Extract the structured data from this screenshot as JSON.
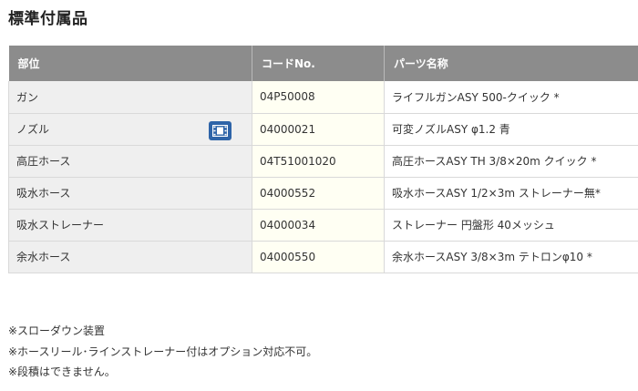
{
  "page": {
    "title": "標準付属品"
  },
  "table": {
    "headers": [
      "部位",
      "コードNo.",
      "パーツ名称"
    ],
    "rows": [
      {
        "part": "ガン",
        "code": "04P50008",
        "name": "ライフルガンASY 500-クイック *"
      },
      {
        "part": "ノズル",
        "code": "04000021",
        "name": "可変ノズルASY φ1.2 青",
        "icon": "video-film-icon"
      },
      {
        "part": "高圧ホース",
        "code": "04T51001020",
        "name": "高圧ホースASY TH 3/8×20m クイック *"
      },
      {
        "part": "吸水ホース",
        "code": "04000552",
        "name": "吸水ホースASY 1/2×3m ストレーナー無*"
      },
      {
        "part": "吸水ストレーナー",
        "code": "04000034",
        "name": "ストレーナー 円盤形 40メッシュ"
      },
      {
        "part": "余水ホース",
        "code": "04000550",
        "name": "余水ホースASY 3/8×3m テトロンφ10 *"
      }
    ]
  },
  "notes": [
    "※スローダウン装置",
    "※ホースリール･ラインストレーナー付はオプション対応不可。",
    "※段積はできません。"
  ],
  "colors": {
    "header_bg": "#8c8c8c",
    "part_bg": "#efefef",
    "code_bg": "#fffff3",
    "icon_bg": "#2e64a8"
  }
}
